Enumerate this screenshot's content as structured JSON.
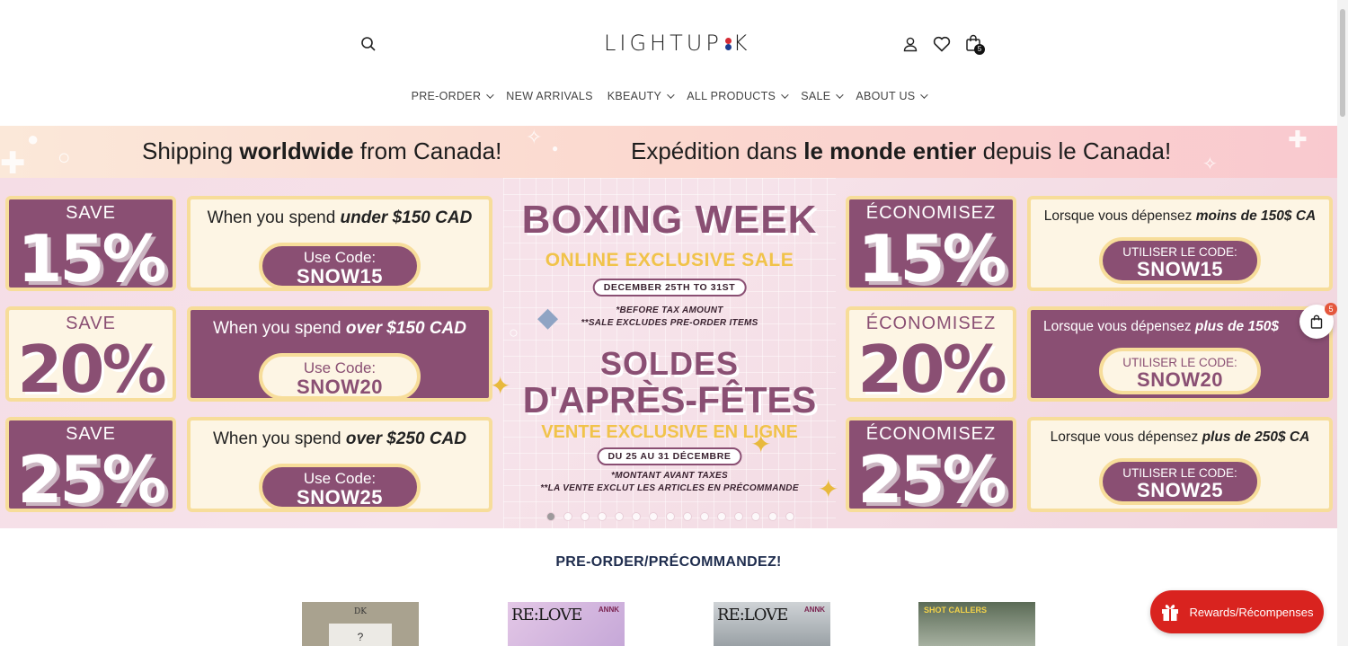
{
  "header": {
    "logo_text_left": "LIGHTUP",
    "logo_text_right": "K",
    "cart_count": "5"
  },
  "nav": [
    {
      "label": "PRE-ORDER",
      "dropdown": true
    },
    {
      "label": "NEW ARRIVALS",
      "dropdown": false
    },
    {
      "label": "KBEAUTY",
      "dropdown": true
    },
    {
      "label": "ALL PRODUCTS",
      "dropdown": true
    },
    {
      "label": "SALE",
      "dropdown": true
    },
    {
      "label": "ABOUT US",
      "dropdown": true
    }
  ],
  "strip": {
    "en_pre": "Shipping ",
    "en_bold": "worldwide",
    "en_post": " from Canada!",
    "fr_pre": "Expédition dans ",
    "fr_bold": "le monde entier",
    "fr_post": " depuis le Canada!"
  },
  "hero": {
    "en": [
      {
        "save": "SAVE",
        "pct": "15%",
        "spend_pre": "When you spend ",
        "spend_bold": "under $150 CAD",
        "code_label": "Use Code:",
        "code": "SNOW15"
      },
      {
        "save": "SAVE",
        "pct": "20%",
        "spend_pre": "When you spend ",
        "spend_bold": "over $150 CAD",
        "code_label": "Use Code:",
        "code": "SNOW20"
      },
      {
        "save": "SAVE",
        "pct": "25%",
        "spend_pre": "When you spend ",
        "spend_bold": "over $250 CAD",
        "code_label": "Use Code:",
        "code": "SNOW25"
      }
    ],
    "fr": [
      {
        "save": "ÉCONOMISEZ",
        "pct": "15%",
        "spend_pre": "Lorsque vous dépensez ",
        "spend_bold": "moins de 150$ CA",
        "code_label": "UTILISER LE CODE:",
        "code": "SNOW15"
      },
      {
        "save": "ÉCONOMISEZ",
        "pct": "20%",
        "spend_pre": "Lorsque vous dépensez ",
        "spend_bold": "plus de 150$",
        "code_label": "UTILISER LE CODE:",
        "code": "SNOW20"
      },
      {
        "save": "ÉCONOMISEZ",
        "pct": "25%",
        "spend_pre": "Lorsque vous dépensez ",
        "spend_bold": "plus de 250$ CA",
        "code_label": "UTILISER LE CODE:",
        "code": "SNOW25"
      }
    ],
    "boxing_week": "BOXING WEEK",
    "online_exclusive": "ONLINE EXCLUSIVE SALE",
    "dates_en": "DECEMBER 25TH TO 31ST",
    "note_en_1": "*BEFORE TAX AMOUNT",
    "note_en_2": "**SALE EXCLUDES PRE-ORDER ITEMS",
    "soldes": "SOLDES",
    "apres_fetes": "D'APRÈS-FÊTES",
    "vente": "VENTE EXCLUSIVE EN LIGNE",
    "dates_fr": "DU 25 AU 31 DÉCEMBRE",
    "note_fr_1": "*MONTANT AVANT TAXES",
    "note_fr_2": "**LA VENTE EXCLUT LES ARTICLES EN PRÉCOMMANDE",
    "slide_count": 15,
    "active_slide": 1
  },
  "floating_cart": {
    "count": "5"
  },
  "section": {
    "title": "PRE-ORDER/PRÉCOMMANDEZ!"
  },
  "products": [
    {
      "text": "DK",
      "subtext": "?"
    },
    {
      "text": "RE:LOVE",
      "tag": "ANNK"
    },
    {
      "text": "RE:LOVE",
      "tag": "ANNK"
    },
    {
      "text": "SHOT CALLERS"
    }
  ],
  "rewards": {
    "label": "Rewards/Récompenses"
  },
  "colors": {
    "brand_purple": "#8a4f73",
    "gold": "#f7dd9a",
    "rewards_red": "#d9231f",
    "nav_text": "#444444"
  }
}
